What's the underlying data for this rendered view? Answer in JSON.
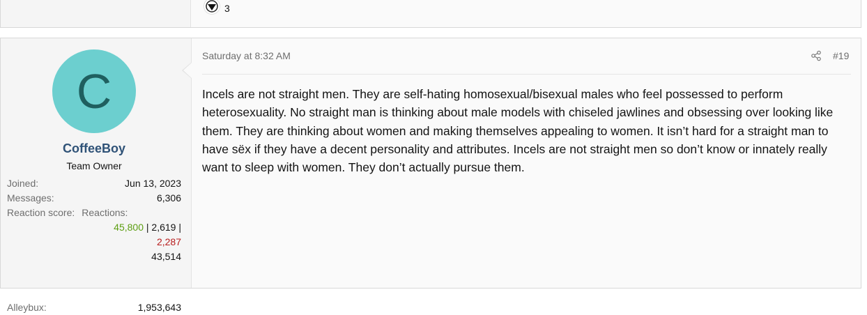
{
  "previous_post": {
    "reaction_count": "3",
    "reaction_icon": "reaction-emoji-icon"
  },
  "post": {
    "user": {
      "avatar_letter": "C",
      "avatar_color": "#6ccfcf",
      "name": "CoffeeBoy",
      "title": "Team Owner",
      "joined_label": "Joined:",
      "joined_value": "Jun 13, 2023",
      "messages_label": "Messages:",
      "messages_value": "6,306",
      "reaction_score_label": "Reaction score:",
      "reactions_label": "Reactions:",
      "reaction_positive": "45,800",
      "reaction_sep1": " | ",
      "reaction_neutral": "2,619",
      "reaction_sep2": " |",
      "reaction_negative": "2,287",
      "reaction_total": "43,514",
      "alleybux_label": "Alleybux:",
      "alleybux_value": "1,953,643"
    },
    "date": "Saturday at 8:32 AM",
    "number": "#19",
    "share_icon": "share-icon",
    "body": "Incels are not straight men. They are self-hating homosexual/bisexual males who feel possessed to perform heterosexuality. No straight man is thinking about male models with chiseled jawlines and obsessing over looking like them. They are thinking about women and making themselves appealing to women. It isn’t hard for a straight man to have sëx if they have a decent personality and attributes. Incels are not straight men so don’t know or innately really want to sleep with women. They don’t actually pursue them."
  },
  "colors": {
    "username": "#2f5277",
    "positive": "#5d9e12",
    "negative": "#b71c1c",
    "muted": "#6e6e6e"
  }
}
